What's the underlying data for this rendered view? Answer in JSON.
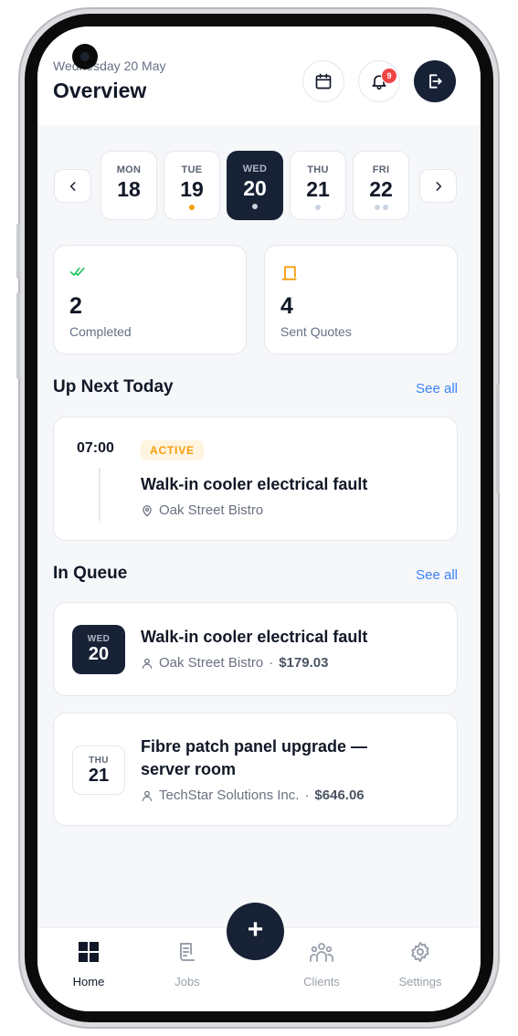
{
  "header": {
    "date_label": "Wednesday 20 May",
    "title": "Overview",
    "notification_count": "9"
  },
  "week": {
    "days": [
      {
        "name": "MON",
        "date": "18"
      },
      {
        "name": "TUE",
        "date": "19"
      },
      {
        "name": "WED",
        "date": "20"
      },
      {
        "name": "THU",
        "date": "21"
      },
      {
        "name": "FRI",
        "date": "22"
      }
    ],
    "selected": "WED"
  },
  "stats": [
    {
      "value": "2",
      "label": "Completed"
    },
    {
      "value": "4",
      "label": "Sent Quotes"
    }
  ],
  "up_next": {
    "title": "Up Next Today",
    "see_all": "See all",
    "job": {
      "time": "07:00",
      "status": "ACTIVE",
      "title": "Walk-in cooler electrical fault",
      "location": "Oak Street Bistro"
    }
  },
  "queue": {
    "title": "In Queue",
    "see_all": "See all",
    "items": [
      {
        "day": "WED",
        "date": "20",
        "title": "Walk-in cooler electrical fault",
        "client": "Oak Street Bistro",
        "sep": "·",
        "price": "$179.03"
      },
      {
        "day": "THU",
        "date": "21",
        "title_line1": "Fibre patch panel upgrade —",
        "title_line2": "server room",
        "client": "TechStar Solutions Inc.",
        "sep": "·",
        "price": "$646.06"
      }
    ]
  },
  "tabs": [
    {
      "label": "Home"
    },
    {
      "label": "Jobs"
    },
    {
      "label": "Clients"
    },
    {
      "label": "Settings"
    }
  ],
  "fab_label": "+",
  "colors": {
    "accent": "#172236",
    "link": "#3b82f6",
    "active": "#f59e0b",
    "badge": "#ef4444",
    "check": "#22c55e"
  }
}
